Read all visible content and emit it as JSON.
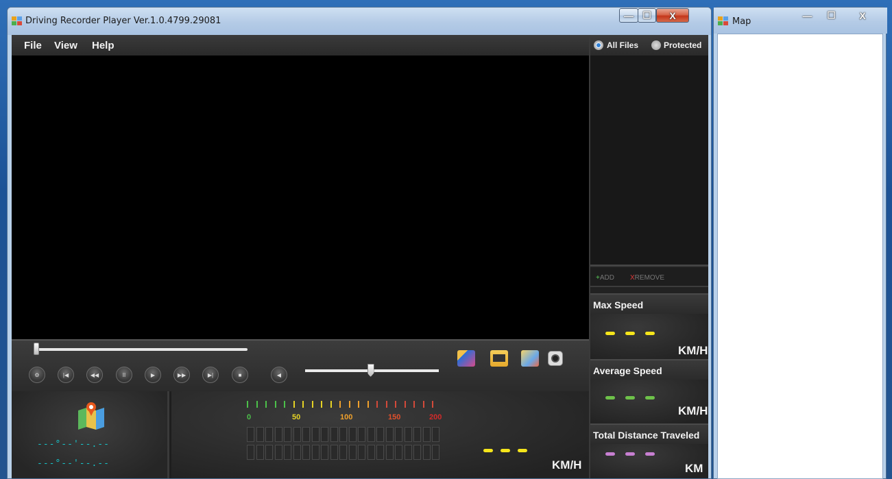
{
  "main_window": {
    "title": "Driving Recorder Player Ver.1.0.4799.29081",
    "minimize": "—",
    "maximize": "☐",
    "close": "X"
  },
  "menu": {
    "file": "File",
    "view": "View",
    "help": "Help"
  },
  "filter": {
    "all_files": "All Files",
    "protected": "Protected"
  },
  "list_actions": {
    "add_sign": "+",
    "add": "ADD",
    "remove_sign": "X",
    "remove": "REMOVE"
  },
  "playback": {
    "buttons": [
      {
        "name": "settings",
        "glyph": "⚙"
      },
      {
        "name": "prev-file",
        "glyph": "|◀"
      },
      {
        "name": "rewind",
        "glyph": "◀◀"
      },
      {
        "name": "pause",
        "glyph": "II"
      },
      {
        "name": "play",
        "glyph": "▶"
      },
      {
        "name": "fast-forward",
        "glyph": "▶▶"
      },
      {
        "name": "next-file",
        "glyph": "▶|"
      },
      {
        "name": "stop",
        "glyph": "■"
      },
      {
        "name": "mute",
        "glyph": "◀"
      }
    ],
    "seek_progress": 0,
    "volume_level": 0.49
  },
  "gps": {
    "latitude": "---°--'--.--",
    "longitude": "---°--'--.--"
  },
  "speedometer": {
    "scale_labels": [
      {
        "text": "0",
        "color": "#4cc14a"
      },
      {
        "text": "50",
        "color": "#e6d325"
      },
      {
        "text": "100",
        "color": "#f0a12c"
      },
      {
        "text": "150",
        "color": "#e0502c"
      },
      {
        "text": "200",
        "color": "#d42a2a"
      }
    ],
    "current_unit": "KM/H",
    "dash_color": "#f5e51b"
  },
  "stats": {
    "max_speed": {
      "label": "Max Speed",
      "unit": "KM/H",
      "color": "#f5e51b"
    },
    "average_speed": {
      "label": "Average Speed",
      "unit": "KM/H",
      "color": "#6ec24a"
    },
    "total_distance": {
      "label": "Total Distance Traveled",
      "unit": "KM",
      "color": "#c77fd1"
    }
  },
  "map_window": {
    "title": "Map",
    "minimize": "—",
    "maximize": "☐",
    "close": "X"
  },
  "colors": {
    "coord": "#17c4c9",
    "add": "#5bd05b",
    "remove": "#e03a3a"
  }
}
